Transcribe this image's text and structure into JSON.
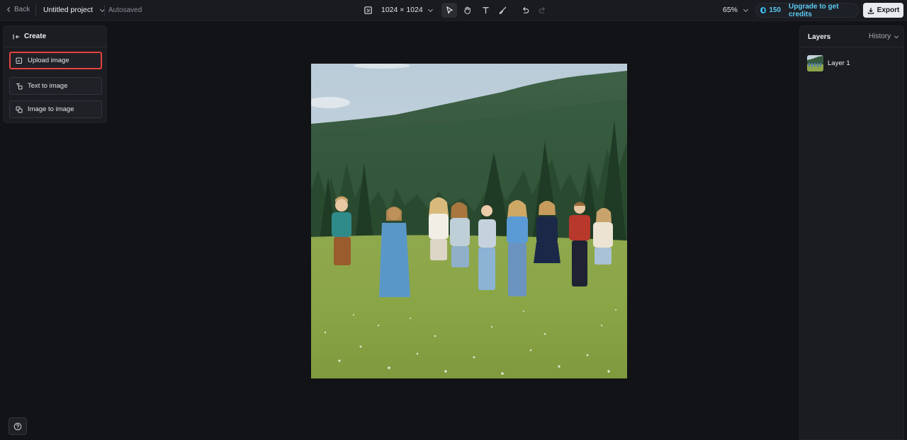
{
  "topbar": {
    "back_label": "Back",
    "project_name": "Untitled project",
    "autosave_status": "Autosaved",
    "canvas_size": "1024 × 1024",
    "zoom": "65%",
    "credits": "150",
    "upgrade_label": "Upgrade to get credits",
    "export_label": "Export",
    "tools": [
      "select-tool",
      "hand-tool",
      "text-tool",
      "brush-tool",
      "undo",
      "redo"
    ]
  },
  "create_panel": {
    "title": "Create",
    "options": [
      {
        "label": "Upload image",
        "icon": "upload-image-icon",
        "highlighted": true
      },
      {
        "label": "Text to image",
        "icon": "text-to-image-icon"
      },
      {
        "label": "Image to image",
        "icon": "image-to-image-icon"
      }
    ]
  },
  "layers_panel": {
    "title": "Layers",
    "history_label": "History",
    "layers": [
      {
        "name": "Layer 1"
      }
    ]
  },
  "colors": {
    "background": "#121317",
    "panel": "#1c1d22",
    "accent": "#5ccbf1",
    "highlight": "#e5443e"
  }
}
